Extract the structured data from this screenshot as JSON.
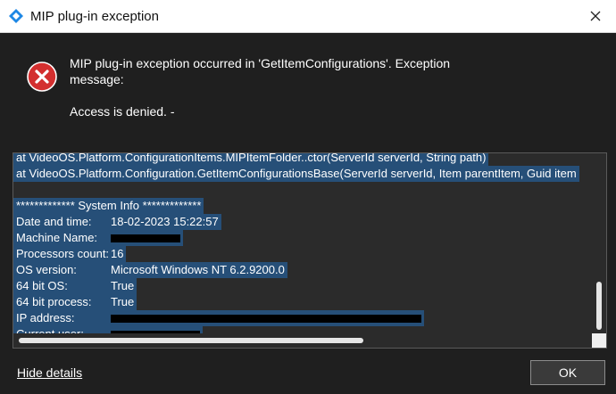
{
  "window": {
    "title": "MIP plug-in exception",
    "app_icon": "diamond-app-icon",
    "close_icon": "close-icon"
  },
  "message": {
    "icon": "error-icon",
    "text": "MIP plug-in exception occurred in 'GetItemConfigurations'. Exception message:",
    "detail": "Access is denied. -"
  },
  "details": {
    "stack": [
      "   at VideoOS.Platform.ConfigurationItems.MIPItemFolder..ctor(ServerId serverId, String path)",
      "   at VideoOS.Platform.Configuration.GetItemConfigurationsBase(ServerId serverId, Item parentItem, Guid item"
    ],
    "section_title": "************* System Info *************",
    "rows": [
      {
        "key": "Date and time:",
        "value": "18-02-2023 15:22:57"
      },
      {
        "key": "Machine Name:",
        "value": "",
        "redacted": true
      },
      {
        "key": "Processors count:",
        "value": "16"
      },
      {
        "key": "OS version:",
        "value": "Microsoft Windows NT 6.2.9200.0"
      },
      {
        "key": "64 bit OS:",
        "value": "True"
      },
      {
        "key": "64 bit process:",
        "value": "True"
      },
      {
        "key": "IP address:",
        "value": "",
        "redacted": true
      },
      {
        "key": "Current user:",
        "value": "",
        "redacted": true
      }
    ]
  },
  "footer": {
    "hide_details": "Hide details",
    "ok": "OK"
  },
  "colors": {
    "background": "#1f1f1f",
    "selection": "#264f78",
    "error_red": "#d32f2f"
  }
}
